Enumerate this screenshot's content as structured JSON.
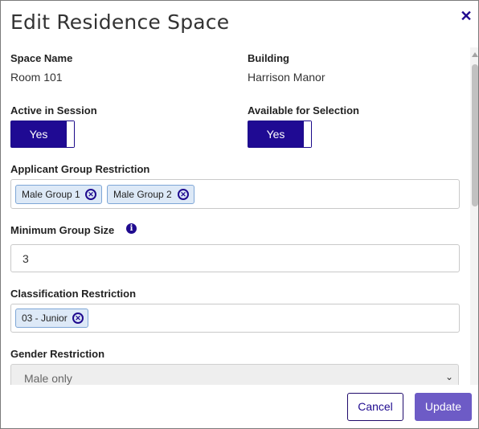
{
  "dialog": {
    "title": "Edit Residence Space",
    "close_icon": "close-icon"
  },
  "fields": {
    "space_name": {
      "label": "Space Name",
      "value": "Room 101"
    },
    "building": {
      "label": "Building",
      "value": "Harrison Manor"
    },
    "active_in_session": {
      "label": "Active in Session",
      "toggle_label": "Yes",
      "state": true
    },
    "available_for_selection": {
      "label": "Available for Selection",
      "toggle_label": "Yes",
      "state": true
    },
    "applicant_group_restriction": {
      "label": "Applicant Group Restriction",
      "chips": [
        "Male Group 1",
        "Male Group 2"
      ]
    },
    "minimum_group_size": {
      "label": "Minimum Group Size",
      "info_icon": "info-icon",
      "value": "3"
    },
    "classification_restriction": {
      "label": "Classification Restriction",
      "chips": [
        "03 - Junior"
      ]
    },
    "gender_restriction": {
      "label": "Gender Restriction",
      "selected": "Male only"
    }
  },
  "footer": {
    "cancel_label": "Cancel",
    "update_label": "Update"
  },
  "colors": {
    "accent": "#1f0a93",
    "chip_bg": "#dde9f7",
    "update_bg": "#6d5bc6"
  }
}
